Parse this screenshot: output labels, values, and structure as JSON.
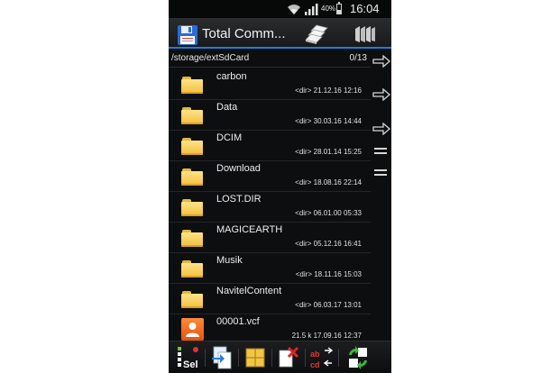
{
  "status_bar": {
    "battery_percent": "40%",
    "time": "16:04"
  },
  "title_bar": {
    "title": "Total Comm..."
  },
  "path_bar": {
    "path": "/storage/extSdCard",
    "count": "0/13"
  },
  "files": [
    {
      "name": "carbon",
      "meta": "<dir> 21.12.16 12:16",
      "type": "folder"
    },
    {
      "name": "Data",
      "meta": "<dir> 30.03.16 14:44",
      "type": "folder"
    },
    {
      "name": "DCIM",
      "meta": "<dir> 28.01.14 15:25",
      "type": "folder"
    },
    {
      "name": "Download",
      "meta": "<dir> 18.08.16 22:14",
      "type": "folder"
    },
    {
      "name": "LOST.DIR",
      "meta": "<dir> 06.01.00 05:33",
      "type": "folder"
    },
    {
      "name": "MAGICEARTH",
      "meta": "<dir> 05.12.16 16:41",
      "type": "folder"
    },
    {
      "name": "Musik",
      "meta": "<dir> 18.11.16 15:03",
      "type": "folder"
    },
    {
      "name": "NavitelContent",
      "meta": "<dir> 06.03.17 13:01",
      "type": "folder"
    },
    {
      "name": "00001.vcf",
      "meta": "21.5 k 17.09.16 12:37",
      "type": "contact-file"
    }
  ],
  "toolbar": {
    "select_label": "Sel"
  },
  "icons": {
    "app": "floppy-disk-icon",
    "copy": "copy-files-icon",
    "directories": "directory-hotlist-icon",
    "select": "select-files-icon",
    "pack": "pack-icon",
    "zip": "zip-icon",
    "delete": "delete-icon",
    "rename": "rename-icon",
    "swap": "swap-panels-icon"
  },
  "colors": {
    "accent": "#1b7fd6",
    "folder": "#f2bf3a",
    "background": "#0d0e0f"
  }
}
